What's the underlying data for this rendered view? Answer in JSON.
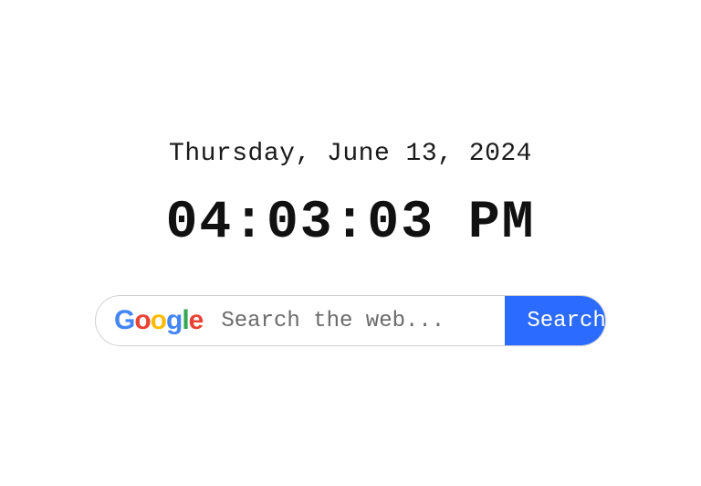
{
  "date": "Thursday, June 13, 2024",
  "time": "04:03:03 PM",
  "search": {
    "logo_text": "Google",
    "placeholder": "Search the web...",
    "button_label": "Search"
  }
}
